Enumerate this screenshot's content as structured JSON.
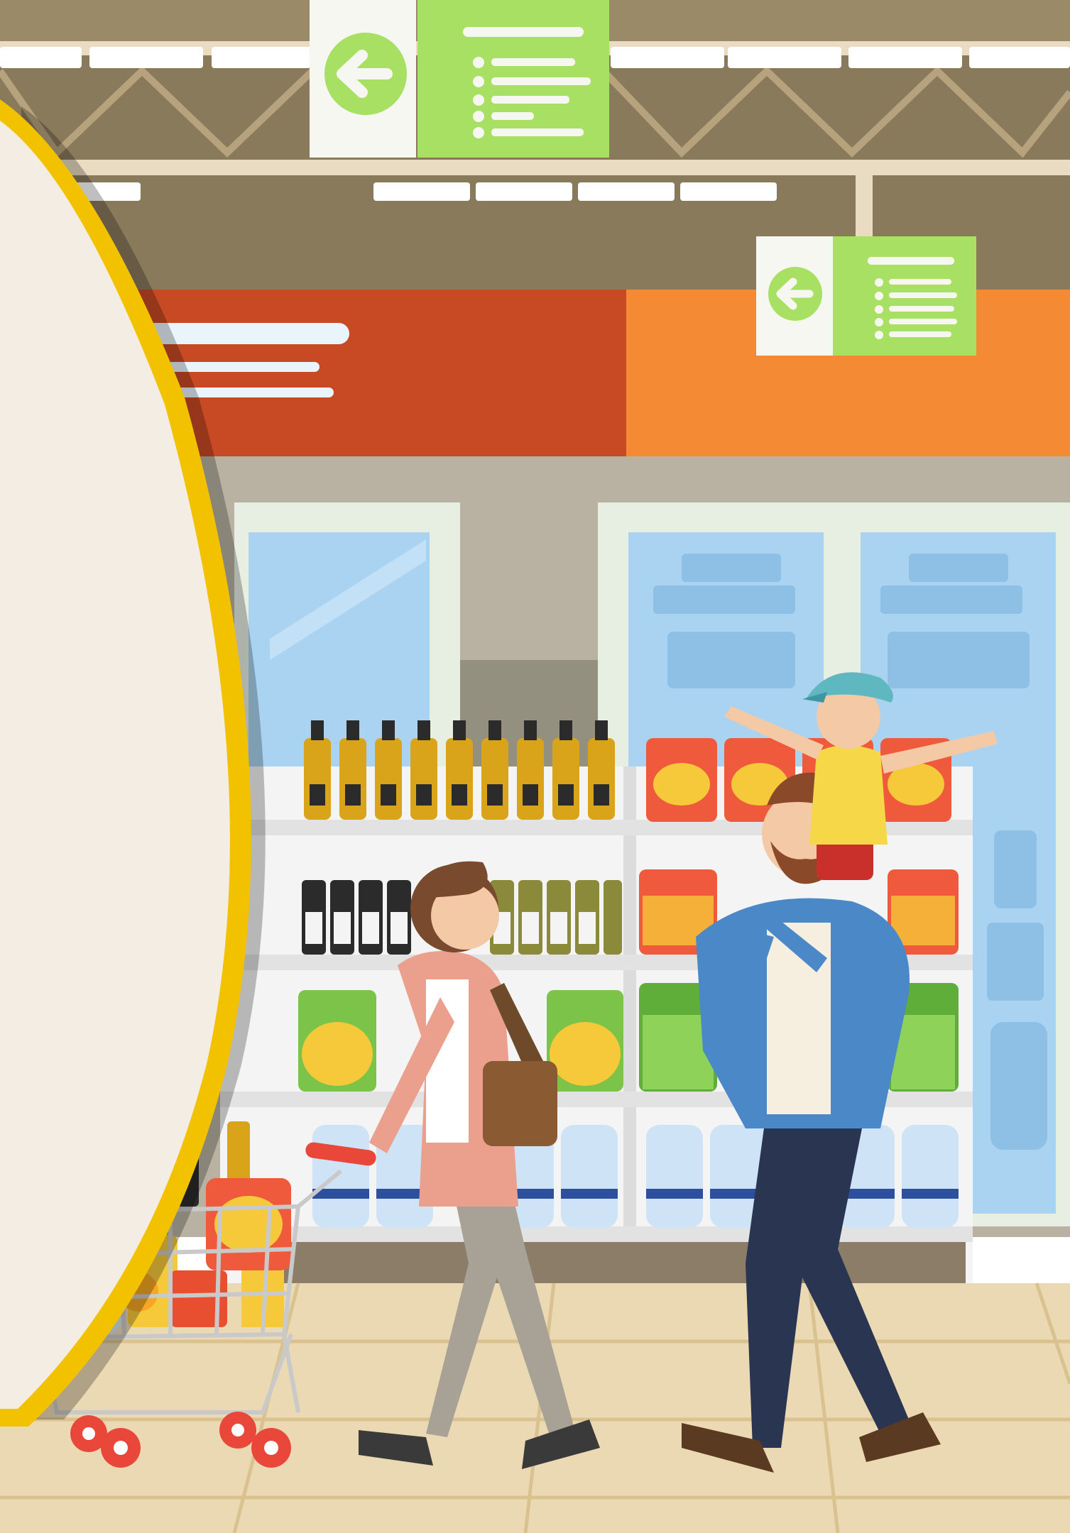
{
  "scene": {
    "description_free": true
  },
  "colors": {
    "ceiling": "#8a7a5c",
    "ceiling_dark": "#6f6248",
    "beam": "#e9dcc2",
    "sign_green": "#a8e063",
    "sign_white": "#f7f7f2",
    "wall_red": "#c84a24",
    "wall_orange": "#f58a35",
    "wall_gray": "#b9b2a2",
    "fridge_frame": "#e7efe3",
    "fridge_glass": "#a9d3f0",
    "shelf_white": "#f4f4f4",
    "floor": "#ebd9b3",
    "floor_line": "#d9c28f",
    "panel_cream": "#f3ede3",
    "panel_yellow": "#f2c200",
    "bottle_yellow": "#d9a31a",
    "water_blue": "#cfe3f6",
    "chips_orange": "#f07a3c",
    "chips_yellow": "#f5c93a",
    "greens": "#7cc34a"
  },
  "icons": {
    "aisle_sign_1": "left-arrow-icon",
    "aisle_sign_2": "left-arrow-icon"
  }
}
